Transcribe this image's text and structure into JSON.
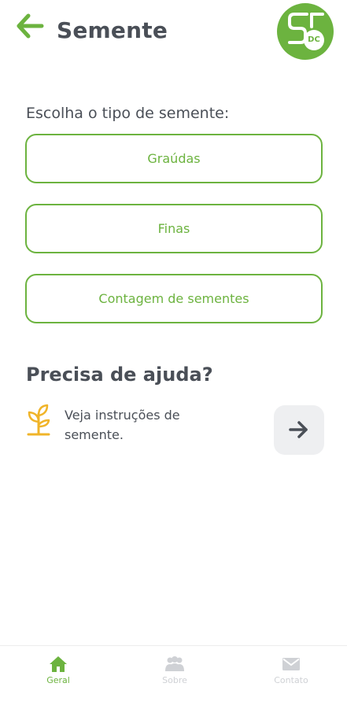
{
  "header": {
    "title": "Semente",
    "back_icon": "arrow-left-icon",
    "logo_badge": "DC"
  },
  "colors": {
    "accent": "#6cb33f",
    "text": "#4a4f57",
    "muted": "#cfd1d5",
    "help_icon": "#f0b429",
    "button_bg": "#eeeff1"
  },
  "seed_types": {
    "label": "Escolha o tipo de semente:",
    "options": [
      {
        "label": "Graúdas"
      },
      {
        "label": "Finas"
      },
      {
        "label": "Contagem de sementes"
      }
    ]
  },
  "help": {
    "title": "Precisa de ajuda?",
    "text": "Veja instruções de semente.",
    "icon": "plant-icon",
    "action_icon": "arrow-right-icon"
  },
  "bottom_nav": [
    {
      "label": "Geral",
      "icon": "home-icon",
      "active": true
    },
    {
      "label": "Sobre",
      "icon": "people-icon",
      "active": false
    },
    {
      "label": "Contato",
      "icon": "mail-icon",
      "active": false
    }
  ]
}
